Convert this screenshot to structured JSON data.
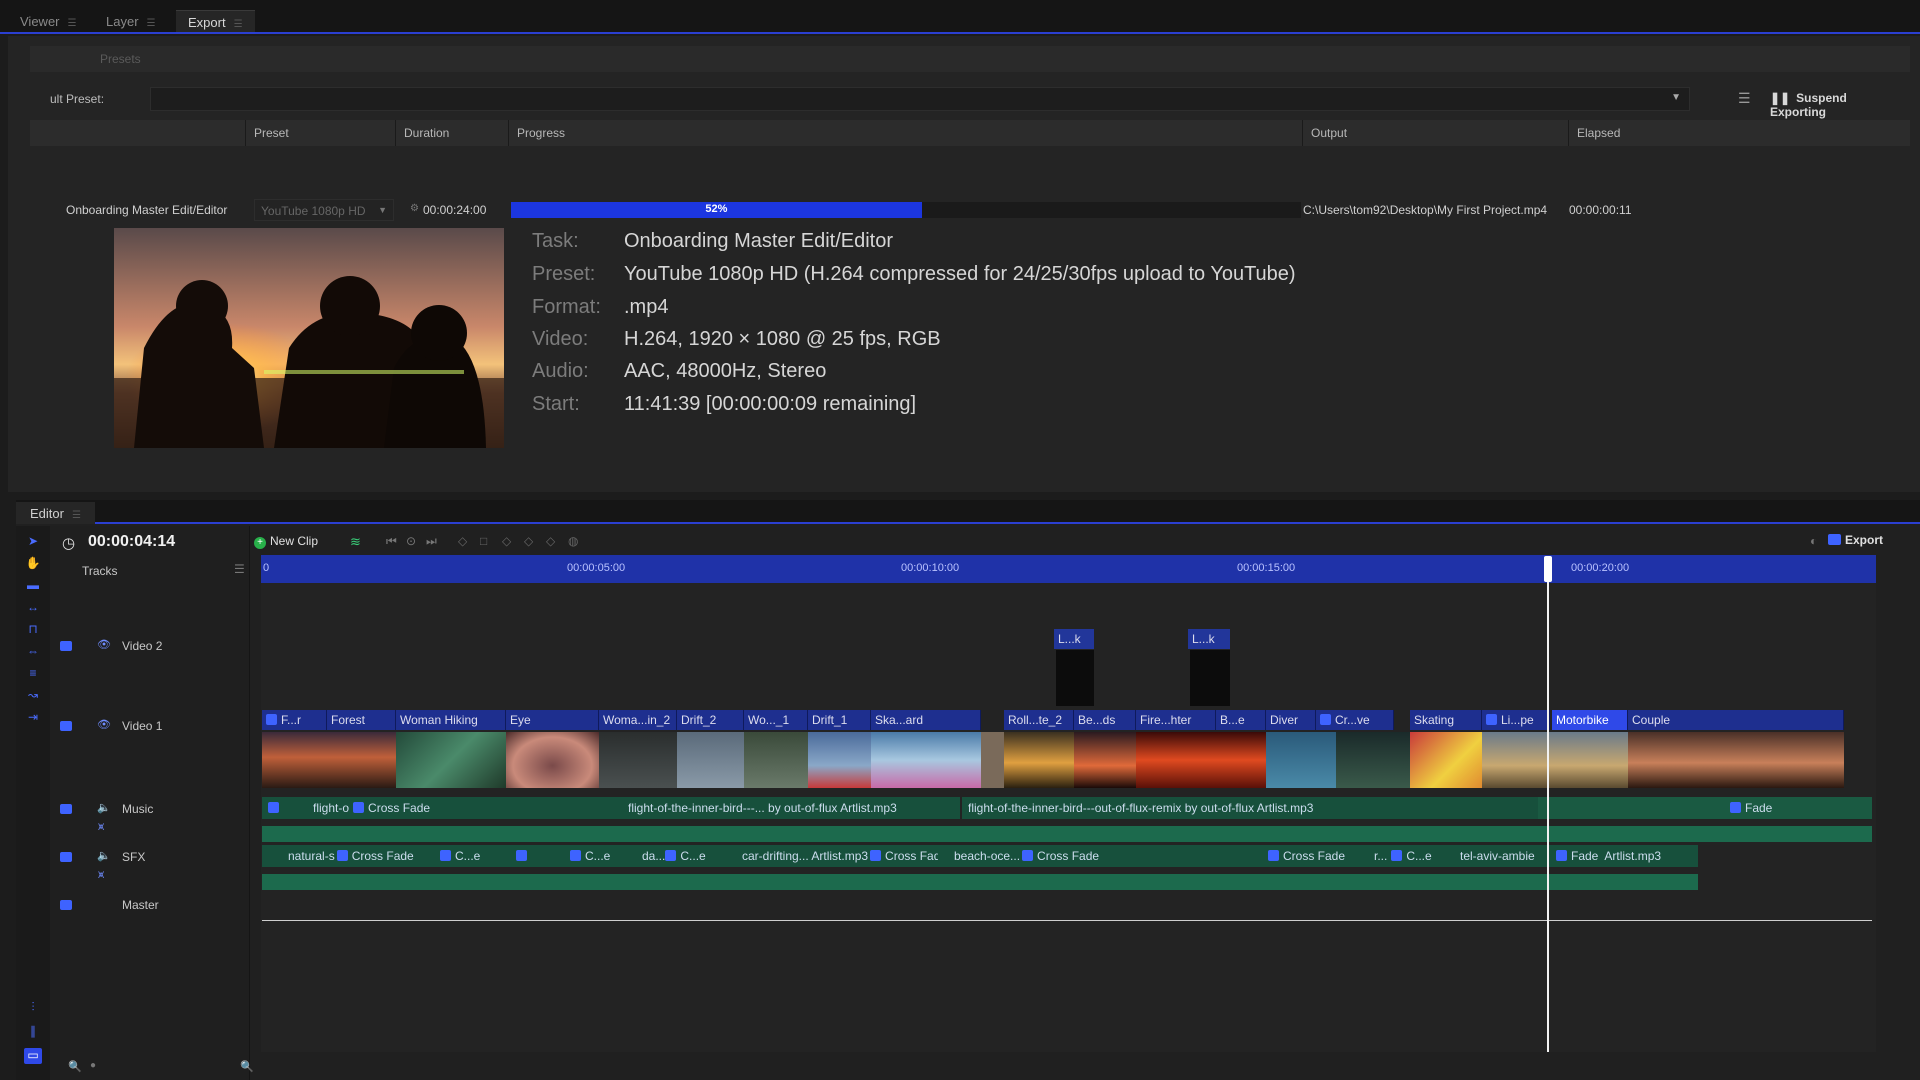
{
  "top_tabs": [
    {
      "label": "Viewer"
    },
    {
      "label": "Layer"
    },
    {
      "label": "Export"
    }
  ],
  "export": {
    "presets_label": "Presets",
    "default_preset_label": "ult Preset:",
    "suspend_label": "Suspend Exporting",
    "columns": {
      "preset": "Preset",
      "duration": "Duration",
      "progress": "Progress",
      "output": "Output",
      "elapsed": "Elapsed"
    },
    "job": {
      "name": "Onboarding Master Edit/Editor",
      "preset": "YouTube 1080p HD",
      "duration": "00:00:24:00",
      "progress_percent": 52,
      "progress_text": "52%",
      "output": "C:\\Users\\tom92\\Desktop\\My First Project.mp4",
      "elapsed": "00:00:00:11"
    },
    "details": {
      "task_label": "Task:",
      "task": "Onboarding Master Edit/Editor",
      "preset_label": "Preset:",
      "preset": "YouTube 1080p HD (H.264 compressed for 24/25/30fps upload to YouTube)",
      "format_label": "Format:",
      "format": ".mp4",
      "video_label": "Video:",
      "video": "H.264, 1920 × 1080 @ 25 fps, RGB",
      "audio_label": "Audio:",
      "audio": "AAC, 48000Hz, Stereo",
      "start_label": "Start:",
      "start": "11:41:39 [00:00:00:09 remaining]"
    }
  },
  "editor": {
    "tab_label": "Editor",
    "timecode": "00:00:04:14",
    "new_clip_label": "New Clip",
    "export_label": "Export",
    "tracks_label": "Tracks",
    "ruler": [
      "0",
      "00:00:05:00",
      "00:00:10:00",
      "00:00:15:00",
      "00:00:20:00"
    ],
    "tracks": [
      {
        "name": "Video 2"
      },
      {
        "name": "Video 1"
      },
      {
        "name": "Music"
      },
      {
        "name": "SFX"
      },
      {
        "name": "Master"
      }
    ],
    "video2_clips": [
      "L...k",
      "L...k"
    ],
    "video1_clips": [
      "F...r",
      "Forest",
      "Woman Hiking",
      "Eye",
      "Woma...in_2",
      "Drift_2",
      "Wo..._1",
      "Drift_1",
      "Ska...ard",
      "Roll...te_2",
      "Be...ds",
      "Fire...hter",
      "B...e",
      "Diver",
      "Cr...ve",
      "Skating",
      "Li...pe",
      "Motorbike",
      "Couple"
    ],
    "music_clips": [
      "flight-o",
      "Cross Fade",
      "flight-of-the-inner-bird---... by out-of-flux Artlist.mp3",
      "flight-of-the-inner-bird---out-of-flux-remix by out-of-flux Artlist.mp3",
      "Fade"
    ],
    "sfx_clips": [
      "natural-s",
      "Cross Fade",
      "C...e",
      "C...e",
      "da...",
      "C...e",
      "car-drifting... Artlist.mp3",
      "Cross Fade",
      "beach-oce...",
      "Cross Fade",
      "Cross Fade",
      "r...",
      "C...e",
      "tel-aviv-ambie",
      "Fade",
      "Artlist.mp3"
    ]
  },
  "colors": {
    "accent": "#2b3fd1",
    "progress": "#1c36e0",
    "clip_video": "#1e2f8f",
    "clip_audio": "#17503c",
    "selected_clip": "#2f49e8"
  }
}
